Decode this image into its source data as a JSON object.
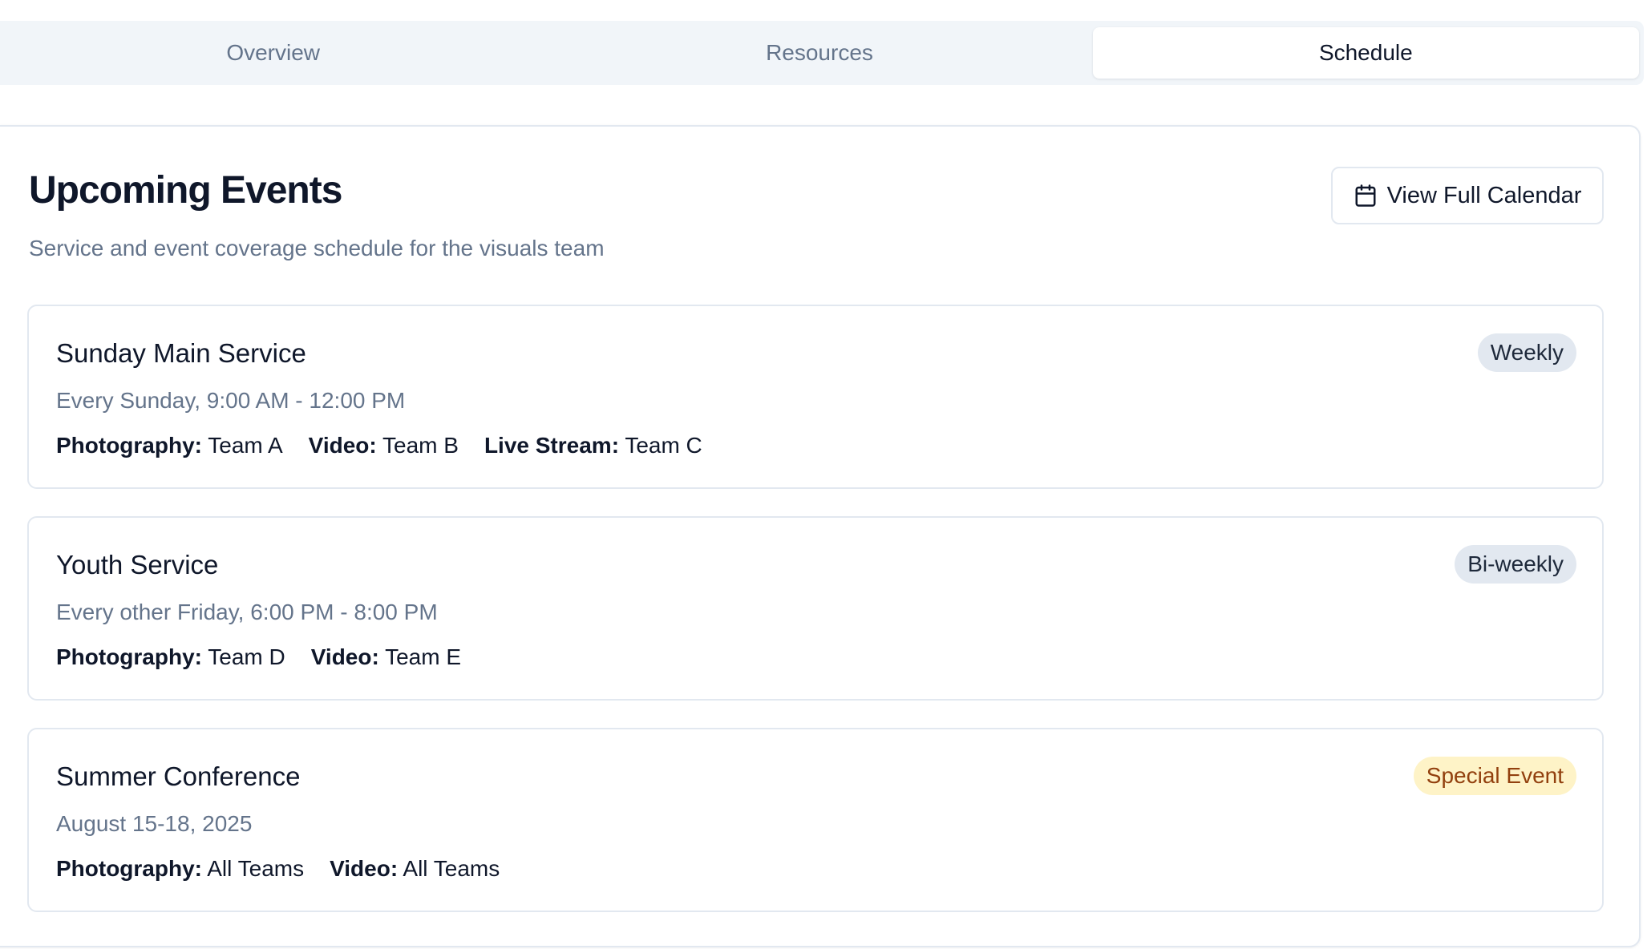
{
  "tabs": [
    {
      "label": "Overview",
      "active": false
    },
    {
      "label": "Resources",
      "active": false
    },
    {
      "label": "Schedule",
      "active": true
    }
  ],
  "card": {
    "title": "Upcoming Events",
    "subtitle": "Service and event coverage schedule for the visuals team",
    "calendar_button": {
      "label": "View Full Calendar",
      "icon": "calendar-icon"
    }
  },
  "events": [
    {
      "title": "Sunday Main Service",
      "when": "Every Sunday, 9:00 AM - 12:00 PM",
      "badge": "Weekly",
      "badge_style": "neutral",
      "assignments": [
        {
          "role": "Photography:",
          "team": "Team A"
        },
        {
          "role": "Video:",
          "team": "Team B"
        },
        {
          "role": "Live Stream:",
          "team": "Team C"
        }
      ]
    },
    {
      "title": "Youth Service",
      "when": "Every other Friday, 6:00 PM - 8:00 PM",
      "badge": "Bi-weekly",
      "badge_style": "neutral",
      "assignments": [
        {
          "role": "Photography:",
          "team": "Team D"
        },
        {
          "role": "Video:",
          "team": "Team E"
        }
      ]
    },
    {
      "title": "Summer Conference",
      "when": "August 15-18, 2025",
      "badge": "Special Event",
      "badge_style": "special",
      "assignments": [
        {
          "role": "Photography:",
          "team": "All Teams"
        },
        {
          "role": "Video:",
          "team": "All Teams"
        }
      ]
    }
  ],
  "colors": {
    "text_primary": "#0f172a",
    "text_muted": "#64748b",
    "border": "#e2e8f0",
    "tab_bar_bg": "#f1f5f9",
    "badge_neutral_bg": "#e2e8f0",
    "badge_special_bg": "#fef3c7",
    "badge_special_text": "#92400e"
  }
}
